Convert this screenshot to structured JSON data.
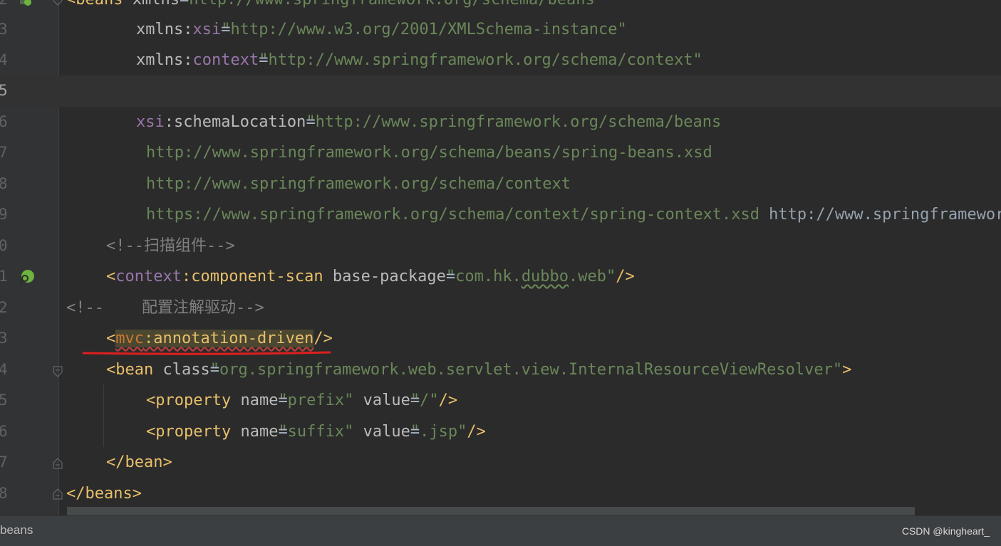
{
  "editor": {
    "lines": [
      {
        "num": "2",
        "parts": [
          [
            "tag",
            "<beans "
          ],
          [
            "attr",
            "xmlns"
          ],
          [
            "code",
            "="
          ],
          [
            "val",
            "\"http://www.springframework.org/schema/beans\""
          ]
        ]
      },
      {
        "num": "3",
        "parts": [
          [
            "attr",
            "xmlns:"
          ],
          [
            "ns",
            "xsi"
          ],
          [
            "code",
            "="
          ],
          [
            "val",
            "\"http://www.w3.org/2001/XMLSchema-instance\""
          ]
        ]
      },
      {
        "num": "4",
        "parts": [
          [
            "attr",
            "xmlns:"
          ],
          [
            "ns",
            "context"
          ],
          [
            "code",
            "="
          ],
          [
            "val",
            "\"http://www.springframework.org/schema/context\""
          ]
        ]
      },
      {
        "num": "5",
        "parts": []
      },
      {
        "num": "6",
        "parts": [
          [
            "ns",
            "xsi"
          ],
          [
            "attr",
            ":schemaLocation"
          ],
          [
            "code",
            "="
          ],
          [
            "val",
            "\"http://www.springframework.org/schema/beans"
          ]
        ]
      },
      {
        "num": "7",
        "parts": [
          [
            "val",
            "http://www.springframework.org/schema/beans/spring-beans.xsd"
          ]
        ]
      },
      {
        "num": "8",
        "parts": [
          [
            "val",
            "http://www.springframework.org/schema/context"
          ]
        ]
      },
      {
        "num": "9",
        "parts": [
          [
            "val",
            "https://www.springframework.org/schema/context/spring-context.xsd"
          ],
          [
            "plain",
            " http://www.springframework.org/schema/mvc"
          ]
        ]
      },
      {
        "num": "0",
        "parts": [
          [
            "cmt",
            "<!--扫描组件-->"
          ]
        ]
      },
      {
        "num": "1",
        "parts": [
          [
            "tag",
            "<"
          ],
          [
            "ns",
            "context"
          ],
          [
            "tag",
            ":component-scan "
          ],
          [
            "attr",
            "base-package"
          ],
          [
            "code",
            "="
          ],
          [
            "val",
            "\"com.hk."
          ],
          [
            "typo",
            "dubbo"
          ],
          [
            "val",
            ".web\""
          ],
          [
            "tag",
            "/>"
          ]
        ]
      },
      {
        "num": "2",
        "parts": [
          [
            "cmt",
            "<!--    配置注解驱动-->"
          ]
        ]
      },
      {
        "num": "3",
        "parts": [
          [
            "tag",
            "<"
          ],
          [
            "mvc",
            "mvc"
          ],
          [
            "mvctag",
            ":annotation-driven"
          ],
          [
            "tag",
            "/>"
          ]
        ]
      },
      {
        "num": "4",
        "parts": [
          [
            "tag",
            "<bean "
          ],
          [
            "attr",
            "class"
          ],
          [
            "code",
            "="
          ],
          [
            "val",
            "\"org.springframework.web.servlet.view.InternalResourceViewResolver\""
          ],
          [
            "tag",
            ">"
          ]
        ]
      },
      {
        "num": "5",
        "parts": [
          [
            "tag",
            "<property "
          ],
          [
            "attr",
            "name"
          ],
          [
            "code",
            "="
          ],
          [
            "val",
            "\"prefix\" "
          ],
          [
            "attr",
            "value"
          ],
          [
            "code",
            "="
          ],
          [
            "val",
            "\"/\""
          ],
          [
            "tag",
            "/>"
          ]
        ]
      },
      {
        "num": "6",
        "parts": [
          [
            "tag",
            "<property "
          ],
          [
            "attr",
            "name"
          ],
          [
            "code",
            "="
          ],
          [
            "val",
            "\"suffix\" "
          ],
          [
            "attr",
            "value"
          ],
          [
            "code",
            "="
          ],
          [
            "val",
            "\".jsp\""
          ],
          [
            "tag",
            "/>"
          ]
        ]
      },
      {
        "num": "7",
        "parts": [
          [
            "tag",
            "</bean>"
          ]
        ]
      },
      {
        "num": "8",
        "parts": [
          [
            "tag",
            "</beans>"
          ]
        ]
      }
    ],
    "current_line_num": "5"
  },
  "statusbar": {
    "breadcrumb": "beans",
    "watermark": "CSDN @kingheart_"
  },
  "colors": {
    "background": "#2b2b2b",
    "gutter": "#313335",
    "tag": "#e8bf6a",
    "string": "#6a8759",
    "namespace": "#9876aa",
    "comment": "#808080",
    "error_underline": "#e01f1f"
  }
}
